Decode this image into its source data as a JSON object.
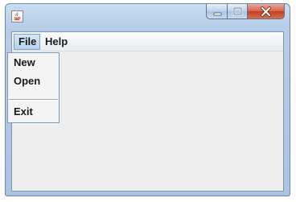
{
  "window": {
    "app_icon": "java-coffee-cup-icon",
    "controls": {
      "minimize_icon": "minimize-icon",
      "maximize_icon": "maximize-icon",
      "close_icon": "close-icon"
    },
    "colors": {
      "frame": "#b7cde8",
      "close_button": "#c94a30",
      "client_background": "#eeeeee"
    }
  },
  "menubar": {
    "menus": [
      {
        "label": "File",
        "open": true
      },
      {
        "label": "Help",
        "open": false
      }
    ]
  },
  "file_menu": {
    "items": [
      {
        "label": "New"
      },
      {
        "label": "Open"
      },
      {
        "label": "Exit"
      }
    ]
  }
}
